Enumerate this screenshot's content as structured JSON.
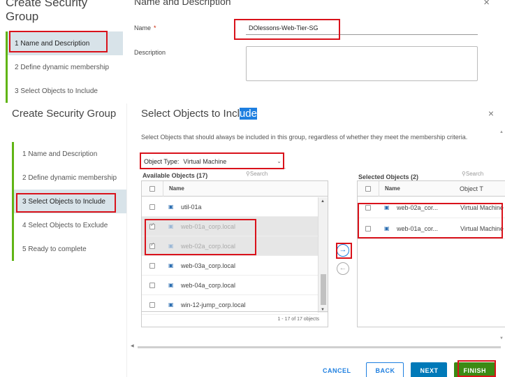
{
  "top_wizard": {
    "title": "Create Security Group",
    "heading": "Name and Description",
    "close_icon": "×",
    "steps": [
      {
        "label": "1  Name and Description",
        "active": true
      },
      {
        "label": "2  Define dynamic membership",
        "active": false
      },
      {
        "label": "3  Select Objects to Include",
        "active": false
      }
    ],
    "name_label": "Name",
    "required_mark": "*",
    "name_value": "DOlessons-Web-Tier-SG",
    "description_label": "Description"
  },
  "wizard": {
    "title": "Create Security Group",
    "steps": [
      {
        "label": "1  Name and Description",
        "active": false
      },
      {
        "label": "2  Define dynamic membership",
        "active": false
      },
      {
        "label": "3  Select Objects to Include",
        "active": true
      },
      {
        "label": "4  Select Objects to Exclude",
        "active": false
      },
      {
        "label": "5  Ready to complete",
        "active": false
      }
    ]
  },
  "main": {
    "heading_prefix": "Select Objects to Incl",
    "heading_highlight": "ude",
    "close_icon": "×",
    "description": "Select Objects that should always be included in this group, regardless of whether they meet the membership criteria.",
    "object_type_label": "Object Type:",
    "object_type_value": "Virtual Machine",
    "available": {
      "title": "Available Objects (17)",
      "search_placeholder": "Search",
      "column_name": "Name",
      "rows": [
        {
          "name": "util-01a",
          "checked": false,
          "selected": false
        },
        {
          "name": "web-01a_corp.local",
          "checked": true,
          "selected": true
        },
        {
          "name": "web-02a_corp.local",
          "checked": true,
          "selected": true
        },
        {
          "name": "web-03a_corp.local",
          "checked": false,
          "selected": false
        },
        {
          "name": "web-04a_corp.local",
          "checked": false,
          "selected": false
        },
        {
          "name": "win-12-jump_corp.local",
          "checked": false,
          "selected": false
        }
      ],
      "footer": "1 - 17 of 17 objects"
    },
    "selected": {
      "title": "Selected Objects (2)",
      "search_placeholder": "Search",
      "column_name": "Name",
      "column_type": "Object T",
      "rows": [
        {
          "name": "web-02a_cor...",
          "type": "Virtual Machine"
        },
        {
          "name": "web-01a_cor...",
          "type": "Virtual Machine"
        }
      ]
    },
    "move_right_icon": "→",
    "move_left_icon": "←",
    "buttons": {
      "cancel": "CANCEL",
      "back": "BACK",
      "next": "NEXT",
      "finish": "FINISH"
    }
  },
  "colors": {
    "accent_blue": "#0079b8",
    "finish_green": "#3c8a14",
    "step_bar_green": "#60b515",
    "annotation_red": "#d9121b",
    "active_step_bg": "#d8e3e9"
  }
}
